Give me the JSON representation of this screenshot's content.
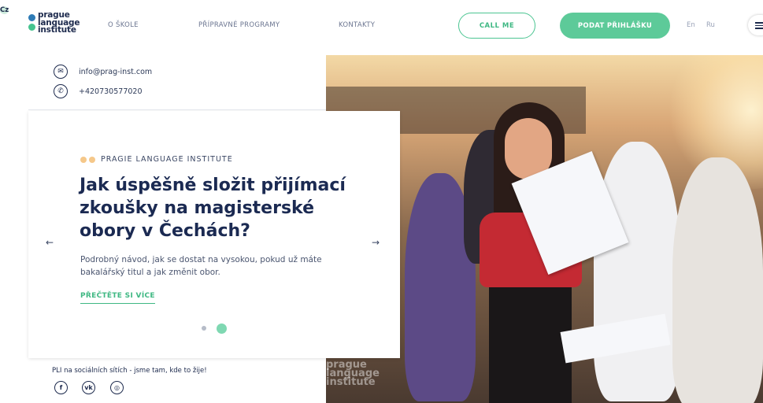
{
  "logo": {
    "lines": [
      "prague",
      "language",
      "institute"
    ]
  },
  "nav": {
    "items": [
      "O ŠKOLE",
      "PŘÍPRAVNÉ PROGRAMY",
      "KONTAKTY"
    ]
  },
  "header": {
    "call_label": "CALL ME",
    "apply_label": "PODAT PŘIHLÁŠKU",
    "languages": [
      "En",
      "Ru",
      "Cz"
    ],
    "active_language": "Cz"
  },
  "contacts": {
    "email": "info@prag-inst.com",
    "phone": "+420730577020"
  },
  "slide": {
    "eyebrow": "PRAGIE LANGUAGE INSTITUTE",
    "title": "Jak úspěšně složit přijímací zkoušky na magisterské obory v Čechách?",
    "description": "Podrobný návod, jak se dostat na vysokou, pokud už máte bakalářský titul a jak změnit obor.",
    "read_more": "PŘEČTĚTE SI VÍCE",
    "prev_arrow": "←",
    "next_arrow": "→",
    "current_slide": 2,
    "total_slides": 2
  },
  "social": {
    "text": "PLI na sociálních sítích - jsme tam, kde to žije!",
    "icons": [
      "facebook-icon",
      "vk-icon",
      "instagram-icon"
    ]
  },
  "photo": {
    "watermark": [
      "prague",
      "language",
      "institute"
    ]
  },
  "colors": {
    "accent": "#5dca99",
    "dark": "#1d2a4d",
    "eyebrow_dot": "#f5c88a",
    "logo_blue": "#2e7bb6"
  }
}
